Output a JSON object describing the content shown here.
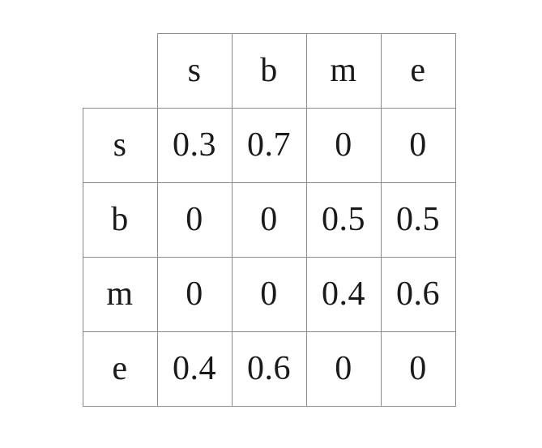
{
  "table": {
    "column_headers": [
      "s",
      "b",
      "m",
      "e"
    ],
    "rows": [
      {
        "label": "s",
        "cells": [
          "0.3",
          "0.7",
          "0",
          "0"
        ]
      },
      {
        "label": "b",
        "cells": [
          "0",
          "0",
          "0.5",
          "0.5"
        ]
      },
      {
        "label": "m",
        "cells": [
          "0",
          "0",
          "0.4",
          "0.6"
        ]
      },
      {
        "label": "e",
        "cells": [
          "0.4",
          "0.6",
          "0",
          "0"
        ]
      }
    ]
  }
}
